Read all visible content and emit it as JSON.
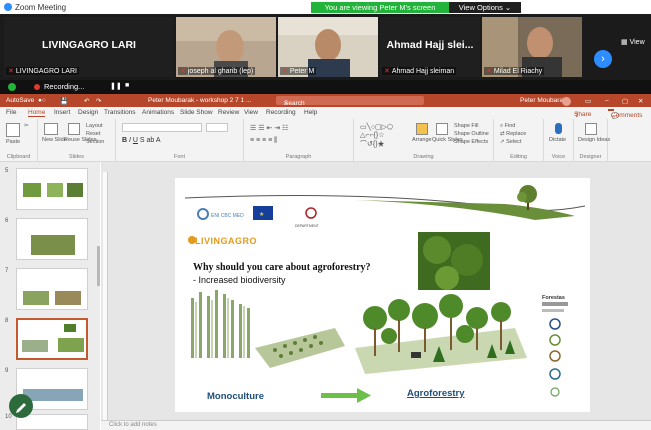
{
  "zoom": {
    "window_title": "Zoom Meeting",
    "viewing_banner": "You are viewing Peter M's screen",
    "view_options": "View Options",
    "view_label": "View"
  },
  "gallery": {
    "tiles": [
      {
        "big_name": "LIVINGAGRO LARI",
        "caption": "LIVINGAGRO LARI"
      },
      {
        "big_name": "",
        "caption": "joseph al gharib (lep)"
      },
      {
        "big_name": "",
        "caption": "Peter M"
      },
      {
        "big_name": "Ahmad Hajj slei...",
        "caption": "Ahmad Hajj sleiman"
      },
      {
        "big_name": "",
        "caption": "Milad El Riachy"
      }
    ]
  },
  "recording": {
    "label": "Recording..."
  },
  "ppt": {
    "autosave": "AutoSave",
    "doc_title": "Peter Moubarak - workshop 2 7 1 ...",
    "search": "Search",
    "user": "Peter Moubarak",
    "user_initials": "PM",
    "menu": [
      "File",
      "Home",
      "Insert",
      "Design",
      "Transitions",
      "Animations",
      "Slide Show",
      "Review",
      "View",
      "Recording",
      "Help"
    ],
    "active_menu": "Home",
    "share": "Share",
    "comments": "Comments",
    "ribbon_groups": [
      "Clipboard",
      "Slides",
      "Font",
      "Paragraph",
      "Drawing",
      "Editing",
      "Voice",
      "Designer"
    ],
    "ribbon_labels": {
      "paste": "Paste",
      "new_slide": "New Slide",
      "reuse": "Reuse Slides",
      "layout": "Layout",
      "reset": "Reset",
      "section": "Section",
      "arrange": "Arrange",
      "quick_styles": "Quick Styles",
      "shape_fill": "Shape Fill",
      "shape_outline": "Shape Outline",
      "shape_effects": "Shape Effects",
      "find": "Find",
      "replace": "Replace",
      "select": "Select",
      "dictate": "Dictate",
      "design_ideas": "Design Ideas"
    },
    "thumb_numbers": [
      "5",
      "6",
      "7",
      "8",
      "9",
      "10"
    ],
    "notes_placeholder": "Click to add notes"
  },
  "slide": {
    "logo_text": "LIVINGAGRO",
    "title": "Why should you care about agroforestry?",
    "bullet": "-   Increased biodiversity",
    "left_label": "Monoculture",
    "right_label": "Agroforestry",
    "forest_label": "Forestas"
  },
  "colors": {
    "ppt_accent": "#b7472a",
    "zoom_green": "#22b33a",
    "zoom_blue": "#2d8cff"
  }
}
